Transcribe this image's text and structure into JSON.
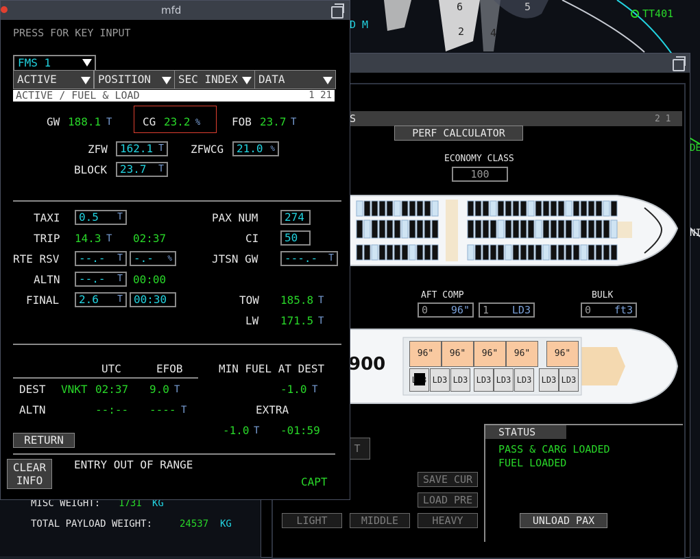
{
  "background": {
    "nav_labels": [
      "TT401",
      "D M",
      "6",
      "2",
      "4",
      "5",
      "DE",
      "NI"
    ]
  },
  "rear_window": {
    "header_left": "S",
    "page_num": "2 1",
    "perf_calc_button": "PERF CALCULATOR",
    "economy_label": "ECONOMY CLASS",
    "economy_value": "100",
    "aft_comp_label": "AFT COMP",
    "aft_comp_count": "0",
    "aft_comp_size": "96\"",
    "aft_comp_ld_count": "1",
    "aft_comp_ld": "LD3",
    "bulk_label": "BULK",
    "bulk_value": "0",
    "bulk_unit": "ft3",
    "model_partial": "900",
    "cargo_top": [
      "96\"",
      "96\"",
      "96\"",
      "96\"",
      "96\""
    ],
    "cargo_bottom": [
      "LD3",
      "LD3",
      "LD3",
      "LD3",
      "LD3",
      "LD3",
      "LD3",
      "LD3"
    ],
    "partial_button": "T",
    "save_cur_button": "SAVE CUR",
    "load_pre_button": "LOAD PRE",
    "light_button": "LIGHT",
    "middle_button": "MIDDLE",
    "heavy_button": "HEAVY",
    "status_title": "STATUS",
    "status_lines": [
      "PASS & CARG LOADED",
      "FUEL LOADED"
    ],
    "unload_pax_button": "UNLOAD PAX",
    "misc_weight_label": "MISC WEIGHT:",
    "misc_weight_value": "1731",
    "total_payload_label": "TOTAL PAYLOAD WEIGHT:",
    "total_payload_value": "24537",
    "kg": "KG"
  },
  "mfd": {
    "window_title": "mfd",
    "key_input_prompt": "PRESS FOR KEY INPUT",
    "fms_select": "FMS 1",
    "menus": [
      "ACTIVE",
      "POSITION",
      "SEC INDEX",
      "DATA"
    ],
    "page_title": "ACTIVE / FUEL & LOAD",
    "page_index": "1 21",
    "gw_label": "GW",
    "gw_value": "188.1",
    "cg_label": "CG",
    "cg_value": "23.2",
    "pct": "%",
    "fob_label": "FOB",
    "fob_value": "23.7",
    "unit_t": "T",
    "zfw_label": "ZFW",
    "zfw_value": "162.1",
    "zfwcg_label": "ZFWCG",
    "zfwcg_value": "21.0",
    "block_label": "BLOCK",
    "block_value": "23.7",
    "taxi_label": "TAXI",
    "taxi_value": "0.5",
    "trip_label": "TRIP",
    "trip_value": "14.3",
    "trip_time": "02:37",
    "rte_rsv_label": "RTE RSV",
    "rte_rsv_value": "--.-",
    "rte_rsv_pct": "-.-",
    "altn_label": "ALTN",
    "altn_value": "--.-",
    "altn_time": "00:00",
    "final_label": "FINAL",
    "final_value": "2.6",
    "final_time": "00:30",
    "pax_num_label": "PAX NUM",
    "pax_num_value": "274",
    "ci_label": "CI",
    "ci_value": "50",
    "jtsn_gw_label": "JTSN GW",
    "jtsn_gw_value": "---.-",
    "tow_label": "TOW",
    "tow_value": "185.8",
    "lw_label": "LW",
    "lw_value": "171.5",
    "utc_header": "UTC",
    "efob_header": "EFOB",
    "min_fuel_label": "MIN FUEL AT DEST",
    "dest_label": "DEST",
    "dest_apt": "VNKT",
    "dest_utc": "02:37",
    "dest_efob": "9.0",
    "min_fuel_value": "-1.0",
    "altn_row_label": "ALTN",
    "altn_utc": "--:--",
    "altn_efob": "----",
    "extra_label": "EXTRA",
    "extra_fuel": "-1.0",
    "extra_time": "-01:59",
    "return_button": "RETURN",
    "clear_info_line1": "CLEAR",
    "clear_info_line2": "INFO",
    "message": "ENTRY OUT OF RANGE",
    "side": "CAPT"
  },
  "colors": {
    "green": "#29d829",
    "cyan": "#22d3e0",
    "blue_unit": "#7aa0d8",
    "amber_box": "#e04030"
  }
}
